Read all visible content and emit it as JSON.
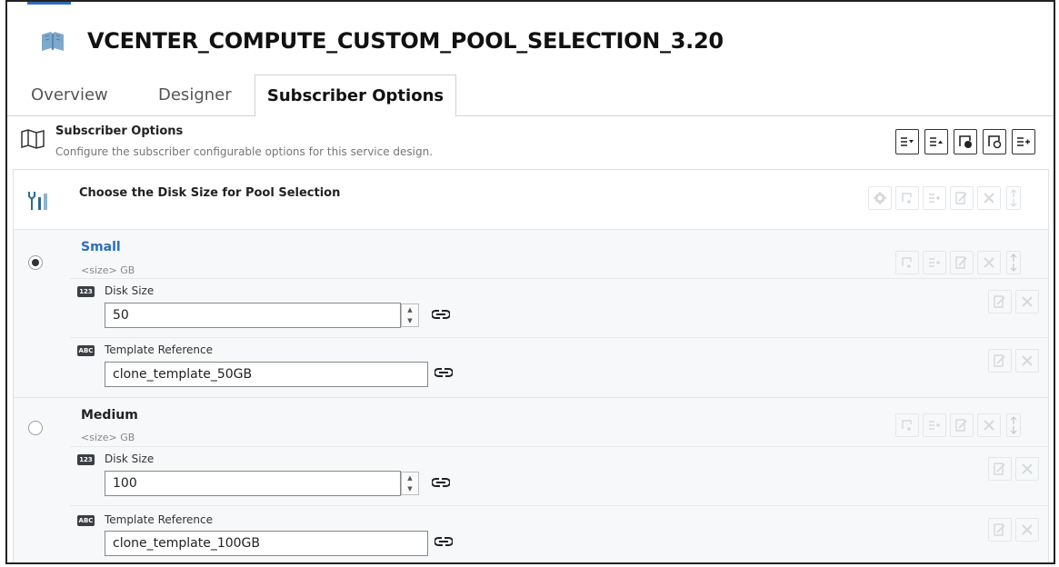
{
  "page": {
    "title": "VCENTER_COMPUTE_CUSTOM_POOL_SELECTION_3.20"
  },
  "tabs": [
    {
      "label": "Overview",
      "active": false
    },
    {
      "label": "Designer",
      "active": false
    },
    {
      "label": "Subscriber Options",
      "active": true
    }
  ],
  "section": {
    "title": "Subscriber Options",
    "description": "Configure the subscriber configurable options for this service design.",
    "toolbar": [
      "collapse-all-icon",
      "expand-all-icon",
      "add-option-set-icon",
      "add-option-icon",
      "add-property-icon"
    ]
  },
  "option_set": {
    "title": "Choose the Disk Size for Pool Selection",
    "choices": [
      {
        "name": "Small",
        "description": "<size> GB",
        "selected": true,
        "properties": [
          {
            "type_badge": "123",
            "label": "Disk Size",
            "value": "50"
          },
          {
            "type_badge": "ABC",
            "label": "Template Reference",
            "value": "clone_template_50GB"
          }
        ]
      },
      {
        "name": "Medium",
        "description": "<size> GB",
        "selected": false,
        "properties": [
          {
            "type_badge": "123",
            "label": "Disk Size",
            "value": "100"
          },
          {
            "type_badge": "ABC",
            "label": "Template Reference",
            "value": "clone_template_100GB"
          }
        ]
      }
    ]
  },
  "colors": {
    "accent": "#2f6db5",
    "selected_choice": "#2a6fb8",
    "choice_bg": "#f3f4f5"
  }
}
